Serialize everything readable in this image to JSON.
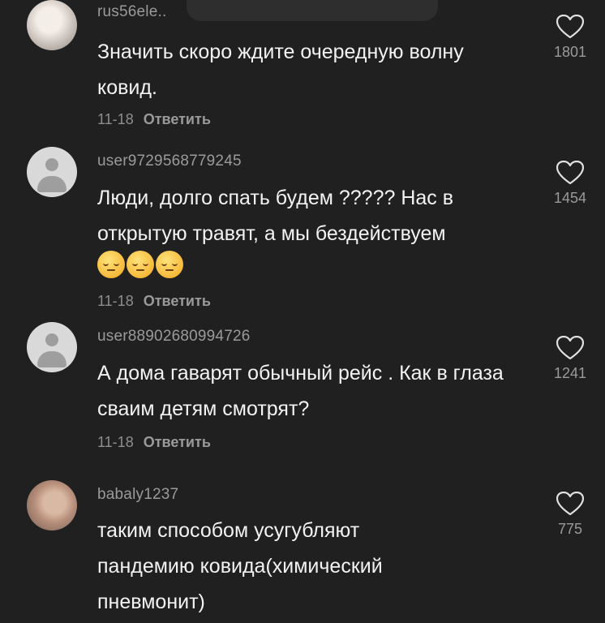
{
  "comments": [
    {
      "username": "rus56ele..",
      "text": "Значить скоро ждите очередную волну ковид.",
      "date": "11-18",
      "reply": "Ответить",
      "likes": "1801",
      "avatar": "photo"
    },
    {
      "username": "user9729568779245",
      "text": "Люди, долго спать будем ????? Нас в открытую травят, а мы бездействуем",
      "emojis": [
        "pensive-face-emoji",
        "pensive-face-emoji",
        "pensive-face-emoji"
      ],
      "date": "11-18",
      "reply": "Ответить",
      "likes": "1454",
      "avatar": "default"
    },
    {
      "username": "user88902680994726",
      "text": "А дома гаварят обычный рейс . Как в глаза сваим детям смотрят?",
      "date": "11-18",
      "reply": "Ответить",
      "likes": "1241",
      "avatar": "default"
    },
    {
      "username": "babaly1237",
      "text": "таким способом усугубляют пандемию ковида(химический пневмонит)",
      "likes": "775",
      "avatar": "photo"
    }
  ],
  "icons": {
    "like": "heart-outline-icon"
  },
  "colors": {
    "background": "#202020",
    "text": "#f2f2f2",
    "muted": "#9a9a9a"
  }
}
